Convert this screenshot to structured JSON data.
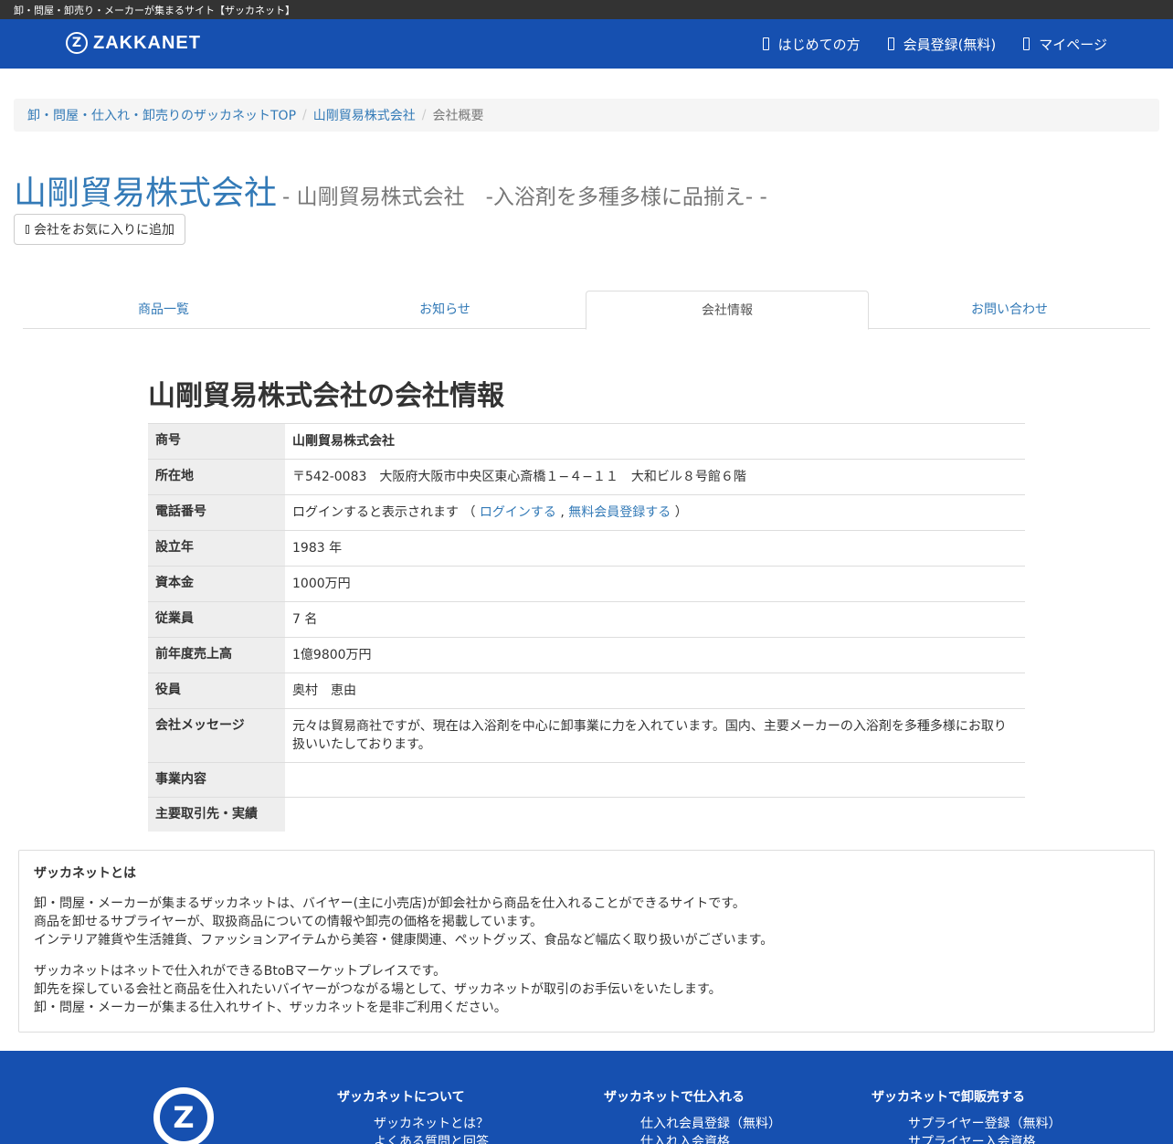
{
  "topbar": {
    "text": "卸・問屋・卸売り・メーカーが集まるサイト【ザッカネット】"
  },
  "header": {
    "logo_text": "ZAKKANET",
    "nav": [
      {
        "label": "はじめての方"
      },
      {
        "label": "会員登録(無料)"
      },
      {
        "label": "マイページ"
      }
    ]
  },
  "breadcrumb": {
    "items": [
      "卸・問屋・仕入れ・卸売りのザッカネットTOP",
      "山剛貿易株式会社"
    ],
    "current": "会社概要"
  },
  "company": {
    "name": "山剛貿易株式会社",
    "subtitle": "- 山剛貿易株式会社　-入浴剤を多種多様に品揃え- -",
    "fav_button": "会社をお気に入りに追加"
  },
  "tabs": [
    {
      "label": "商品一覧",
      "active": false
    },
    {
      "label": "お知らせ",
      "active": false
    },
    {
      "label": "会社情報",
      "active": true
    },
    {
      "label": "お問い合わせ",
      "active": false
    }
  ],
  "info": {
    "title": "山剛貿易株式会社の会社情報",
    "rows": {
      "trade_name": {
        "label": "商号",
        "value": "山剛貿易株式会社"
      },
      "address": {
        "label": "所在地",
        "value": "〒542-0083　大阪府大阪市中央区東心斎橋１−４−１１　大和ビル８号館６階"
      },
      "phone": {
        "label": "電話番号",
        "prefix": "ログインすると表示されます （",
        "login_link": "ログインする",
        "comma": ",",
        "register_link": "無料会員登録する",
        "suffix": "）"
      },
      "founded": {
        "label": "設立年",
        "value": "1983 年"
      },
      "capital": {
        "label": "資本金",
        "value": "1000万円"
      },
      "employees": {
        "label": "従業員",
        "value": "7 名"
      },
      "sales": {
        "label": "前年度売上高",
        "value": "1億9800万円"
      },
      "officer": {
        "label": "役員",
        "value": "奥村　恵由"
      },
      "message": {
        "label": "会社メッセージ",
        "value": "元々は貿易商社ですが、現在は入浴剤を中心に卸事業に力を入れています。国内、主要メーカーの入浴剤を多種多様にお取り扱いいたしております。"
      },
      "business": {
        "label": "事業内容",
        "value": ""
      },
      "clients": {
        "label": "主要取引先・実績",
        "value": ""
      }
    }
  },
  "about": {
    "title": "ザッカネットとは",
    "p1": [
      "卸・問屋・メーカーが集まるザッカネットは、バイヤー(主に小売店)が卸会社から商品を仕入れることができるサイトです。",
      "商品を卸せるサプライヤーが、取扱商品についての情報や卸売の価格を掲載しています。",
      "インテリア雑貨や生活雑貨、ファッションアイテムから美容・健康関連、ペットグッズ、食品など幅広く取り扱いがございます。"
    ],
    "p2": [
      "ザッカネットはネットで仕入れができるBtoBマーケットプレイスです。",
      "卸先を探している会社と商品を仕入れたいバイヤーがつながる場として、ザッカネットが取引のお手伝いをいたします。",
      "卸・問屋・メーカーが集まる仕入れサイト、ザッカネットを是非ご利用ください。"
    ]
  },
  "footer": {
    "cols": [
      {
        "title": "ザッカネットについて",
        "links": [
          "ザッカネットとは？",
          "よくある質問と回答"
        ]
      },
      {
        "title": "ザッカネットで仕入れる",
        "links": [
          "仕入れ会員登録（無料）",
          "仕入れ入会資格"
        ]
      },
      {
        "title": "ザッカネットで卸販売する",
        "links": [
          "サプライヤー登録（無料）",
          "サプライヤー入会資格"
        ]
      }
    ]
  }
}
